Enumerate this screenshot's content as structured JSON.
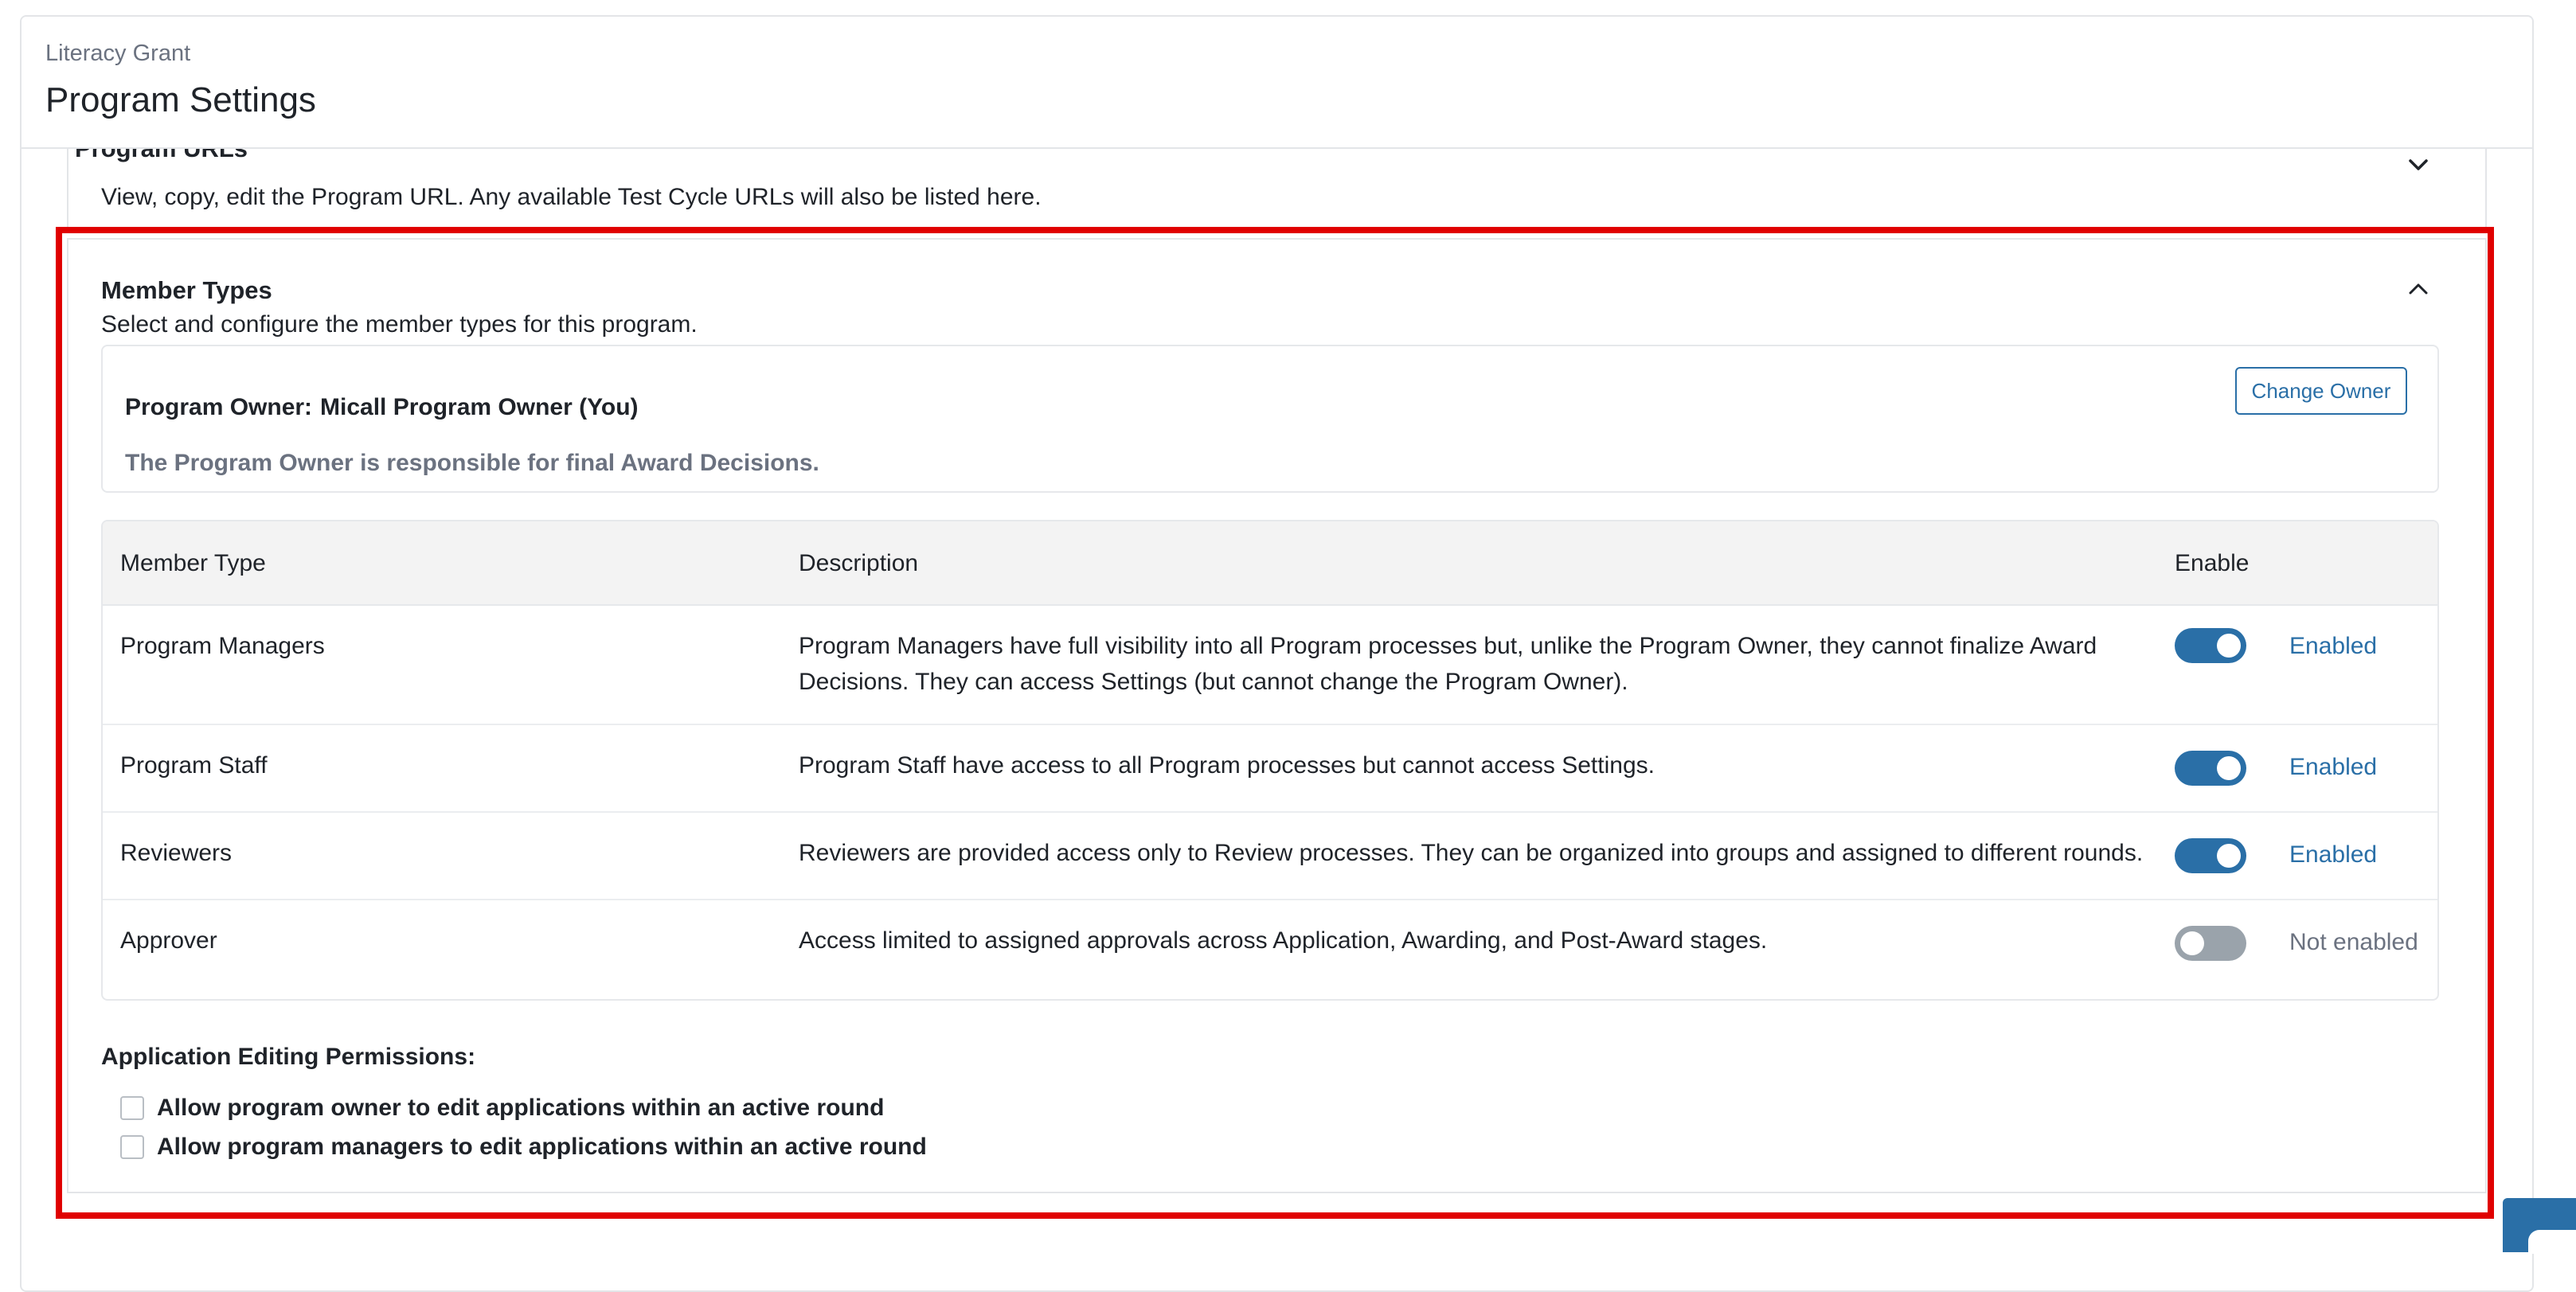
{
  "header": {
    "breadcrumb": "Literacy Grant",
    "title": "Program Settings"
  },
  "program_urls": {
    "title": "Program URLs",
    "description": "View, copy, edit the Program URL. Any available Test Cycle URLs will also be listed here.",
    "chevron_icon": "chevron-down-icon"
  },
  "member_types": {
    "title": "Member Types",
    "description": "Select and configure the member types for this program.",
    "chevron_icon": "chevron-up-icon",
    "owner": {
      "label": "Program Owner:",
      "name": "Micall Program Owner (You)",
      "note": "The Program Owner is responsible for final Award Decisions.",
      "change_button": "Change Owner"
    },
    "table": {
      "headers": [
        "Member Type",
        "Description",
        "Enable"
      ],
      "rows": [
        {
          "type": "Program Managers",
          "description": "Program Managers have full visibility into all Program processes but, unlike the Program Owner, they cannot finalize Award Decisions. They can access Settings (but cannot change the Program Owner).",
          "enabled": true,
          "status": "Enabled"
        },
        {
          "type": "Program Staff",
          "description": "Program Staff have access to all Program processes but cannot access Settings.",
          "enabled": true,
          "status": "Enabled"
        },
        {
          "type": "Reviewers",
          "description": "Reviewers are provided access only to Review processes. They can be organized into groups and assigned to different rounds.",
          "enabled": true,
          "status": "Enabled"
        },
        {
          "type": "Approver",
          "description": "Access limited to assigned approvals across Application, Awarding, and Post-Award stages.",
          "enabled": false,
          "status": "Not enabled"
        }
      ]
    },
    "permissions": {
      "title": "Application Editing Permissions:",
      "options": [
        {
          "label": "Allow program owner to edit applications within an active round",
          "checked": false
        },
        {
          "label": "Allow program managers to edit applications within an active round",
          "checked": false
        }
      ]
    }
  },
  "colors": {
    "accent": "#2a6fa7",
    "highlight": "#e00000",
    "toggle_off": "#9aa3ab",
    "muted_text": "#6b7280"
  }
}
